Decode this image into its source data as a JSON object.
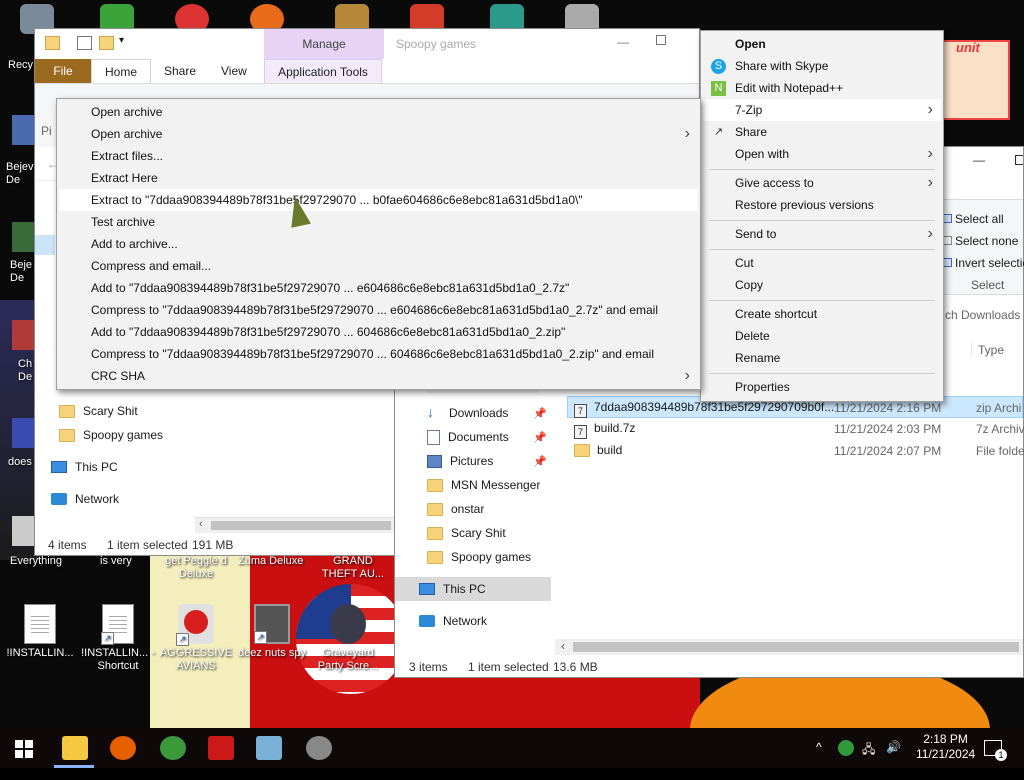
{
  "desktop": {
    "left_icons": [
      "Recy",
      "Bejev De",
      "Beje De",
      "Ch De",
      "does",
      "Everything"
    ],
    "bottom_icons": [
      {
        "label": "!INSTALLIN..."
      },
      {
        "label": "!INSTALLIN... - Shortcut"
      },
      {
        "label": "AGGRESSIVE AVIANS"
      },
      {
        "label": "deez nuts spy"
      },
      {
        "label": "Graveyard Party Scre..."
      }
    ],
    "partial_labels": [
      "is very",
      "get Peggle d Deluxe",
      "Zuma Deluxe",
      "GRAND THEFT AU..."
    ],
    "overlay_text": "unit"
  },
  "window1": {
    "title": "Spoopy games",
    "manage": "Manage",
    "tabs": [
      "File",
      "Home",
      "Share",
      "View"
    ],
    "app_tools": "Application Tools",
    "nav_items": [
      "Scary Shit",
      "Spoopy games",
      "This PC",
      "Network"
    ],
    "status": {
      "items": "4 items",
      "selected": "1 item selected",
      "size": "191 MB"
    },
    "ribbon_select_all": "Select all",
    "partial_pin": "Pi"
  },
  "window2": {
    "ribbon": {
      "select_all": "Select all",
      "select_none": "Select none",
      "invert": "Invert selectio",
      "group": "Select"
    },
    "search_placeholder": "ch Downloads",
    "column_type": "Type",
    "nav_items": [
      {
        "label": "Downloads",
        "icon": "download-icon",
        "pinned": true
      },
      {
        "label": "Documents",
        "icon": "documents-icon",
        "pinned": true
      },
      {
        "label": "Pictures",
        "icon": "pictures-icon",
        "pinned": true
      },
      {
        "label": "MSN Messenger",
        "icon": "folder-icon"
      },
      {
        "label": "onstar",
        "icon": "folder-icon"
      },
      {
        "label": "Scary Shit",
        "icon": "folder-icon"
      },
      {
        "label": "Spoopy games",
        "icon": "folder-icon"
      },
      {
        "label": "This PC",
        "icon": "pc-icon"
      },
      {
        "label": "Network",
        "icon": "network-icon"
      }
    ],
    "files": [
      {
        "name": "7ddaa908394489b78f31be5f297290709b0f...",
        "date": "11/21/2024 2:16 PM",
        "type": "zip Archi",
        "icon": "7z-file-icon"
      },
      {
        "name": "build.7z",
        "date": "11/21/2024 2:03 PM",
        "type": "7z Archiv",
        "icon": "7z-file-icon"
      },
      {
        "name": "build",
        "date": "11/21/2024 2:07 PM",
        "type": "File folde",
        "icon": "folder-icon"
      }
    ],
    "status": {
      "items": "3 items",
      "selected": "1 item selected",
      "size": "13.6 MB"
    }
  },
  "context_menu": {
    "items": [
      {
        "label": "Open",
        "bold": true
      },
      {
        "label": "Share with Skype",
        "icon": "skype-icon"
      },
      {
        "label": "Edit with Notepad++",
        "icon": "notepadpp-icon"
      },
      {
        "label": "7-Zip",
        "submenu": true
      },
      {
        "label": "Share",
        "icon": "share-icon"
      },
      {
        "label": "Open with",
        "submenu": true
      },
      {
        "label": "Give access to",
        "submenu": true
      },
      {
        "label": "Restore previous versions"
      },
      {
        "label": "Send to",
        "submenu": true
      },
      {
        "label": "Cut"
      },
      {
        "label": "Copy"
      },
      {
        "label": "Create shortcut"
      },
      {
        "label": "Delete"
      },
      {
        "label": "Rename"
      },
      {
        "label": "Properties"
      }
    ]
  },
  "zip_menu": {
    "items": [
      "Open archive",
      "Open archive",
      "Extract files...",
      "Extract Here",
      "Extract to \"7ddaa908394489b78f31be5f29729070 ... b0fae604686c6e8ebc81a631d5bd1a0\\\"",
      "Test archive",
      "Add to archive...",
      "Compress and email...",
      "Add to \"7ddaa908394489b78f31be5f29729070 ... e604686c6e8ebc81a631d5bd1a0_2.7z\"",
      "Compress to \"7ddaa908394489b78f31be5f29729070 ... e604686c6e8ebc81a631d5bd1a0_2.7z\" and email",
      "Add to \"7ddaa908394489b78f31be5f29729070 ... 604686c6e8ebc81a631d5bd1a0_2.zip\"",
      "Compress to \"7ddaa908394489b78f31be5f29729070 ... 604686c6e8ebc81a631d5bd1a0_2.zip\" and email",
      "CRC SHA"
    ]
  },
  "taskbar": {
    "time": "2:18 PM",
    "date": "11/21/2024",
    "notification_count": "1",
    "apps": [
      "file-explorer-icon",
      "firefox-icon",
      "msn-icon",
      "flash-icon",
      "notepad-icon",
      "steam-icon"
    ]
  }
}
